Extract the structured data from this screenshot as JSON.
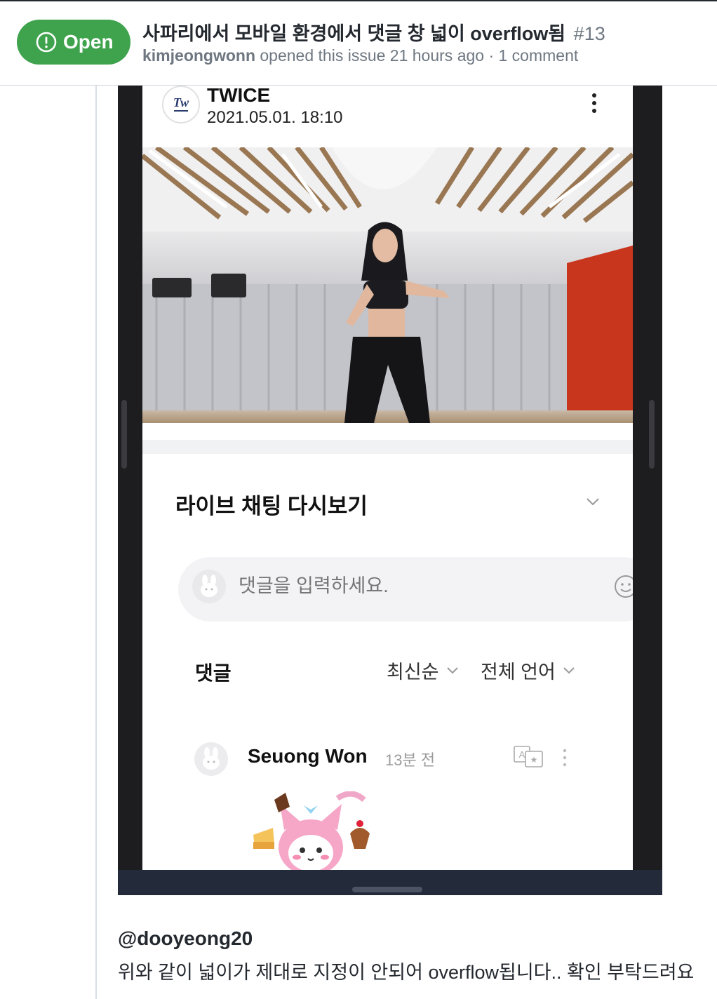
{
  "issue": {
    "state_label": "Open",
    "title": "사파리에서 모바일 환경에서 댓글 창 넓이 overflow됨",
    "number": "#13",
    "author": "kimjeongwonn",
    "meta_text": " opened this issue 21 hours ago · 1 comment",
    "state_color": "#3fa34d"
  },
  "screenshot": {
    "artist_name": "TWICE",
    "post_date": "2021.05.01. 18:10",
    "chat_replay_title": "라이브 채팅 다시보기",
    "comment_placeholder": "댓글을 입력하세요.",
    "comments_label": "댓글",
    "sort_label": "최신순",
    "language_label": "전체 언어",
    "comment": {
      "user": "Seuong Won",
      "time": "13분 전"
    }
  },
  "comment_body": {
    "mention": "@dooyeong20",
    "text": "위와 같이 넓이가 제대로 지정이 안되어 overflow됩니다.. 확인 부탁드려요"
  },
  "icons": {
    "state": "issue-opened-icon",
    "artist_logo": "twice-logo",
    "more": "kebab-icon",
    "chevron": "chevron-down-icon",
    "emoji": "emoji-icon",
    "translate": "translate-icon"
  }
}
